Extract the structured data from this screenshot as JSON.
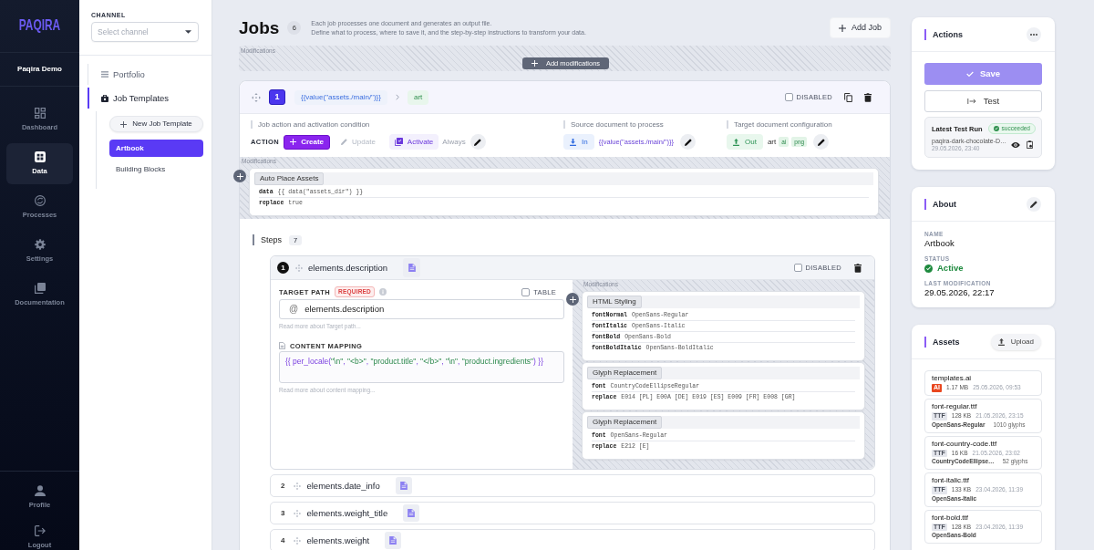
{
  "sidebar": {
    "logo": "PAQIRA",
    "workspace": "Paqira Demo",
    "items": [
      {
        "label": "Dashboard",
        "selected": false
      },
      {
        "label": "Data",
        "selected": true
      },
      {
        "label": "Processes",
        "selected": false
      },
      {
        "label": "Settings",
        "selected": false
      },
      {
        "label": "Documentation",
        "selected": false
      }
    ],
    "footer_items": [
      {
        "label": "Profile"
      },
      {
        "label": "Logout"
      }
    ]
  },
  "channel_panel": {
    "channel_label": "CHANNEL",
    "channel_select": {
      "placeholder": "Select channel"
    },
    "tree": [
      {
        "label": "Portfolio",
        "selected": false
      },
      {
        "label": "Job Templates",
        "selected": true
      }
    ],
    "new_template_button": "New Job Template",
    "templates": [
      {
        "label": "Artbook",
        "selected": true
      },
      {
        "label": "Building Blocks",
        "selected": false
      }
    ]
  },
  "header": {
    "title": "Jobs",
    "count": "6",
    "description": [
      "Each job processes one document and generates an output file.",
      "Define what to process, where to save it, and the step-by-step instructions to transform your data."
    ],
    "add_button": "Add Job"
  },
  "global_modifications": {
    "label": "Modifications",
    "add_button": "Add modifications"
  },
  "job": {
    "number": "1",
    "source": "{{value(\"assets./main/\")}}",
    "target": "art",
    "disabled": false,
    "disabled_label": "DISABLED",
    "action": {
      "title": "Job action and activation condition",
      "label": "ACTION",
      "options": [
        {
          "label": "Create",
          "selected": true
        },
        {
          "label": "Update",
          "selected": false
        }
      ],
      "activate": {
        "label": "Activate",
        "on": true
      },
      "condition": "Always"
    },
    "source_config": {
      "title": "Source document to process",
      "badge": "In",
      "value": "{{value(\"assets./main/\")}}"
    },
    "target_config": {
      "title": "Target document configuration",
      "badge": "Out",
      "name": "art",
      "formats": [
        "ai",
        "png"
      ]
    },
    "modifications": {
      "label": "Modifications",
      "items": [
        {
          "title": "Auto Place Assets",
          "params": [
            {
              "key": "data",
              "value": "{{ data(\"assets_dir\") }}"
            },
            {
              "key": "replace",
              "value": "true"
            }
          ]
        }
      ]
    },
    "steps": {
      "title": "Steps",
      "count": "7",
      "items": [
        {
          "number": "1",
          "name": "elements.description",
          "expanded": true,
          "disabled": false,
          "disabled_label": "DISABLED",
          "detail": {
            "target_path_label": "TARGET PATH",
            "required_badge": "REQUIRED",
            "table_label": "TABLE",
            "table": false,
            "prefix": "@",
            "target_path": "elements.description",
            "target_path_help": "Read more about Target path...",
            "content_mapping_label": "CONTENT MAPPING",
            "content_mapping": "{{ per_locale(\"\\n\", \"<b>\", \"product.title\", \"</b>\", \"\\n\", \"product.ingredients\") }}",
            "content_mapping_help": "Read more about content mapping...",
            "modifications": {
              "label": "Modifications",
              "items": [
                {
                  "title": "HTML Styling",
                  "params": [
                    {
                      "key": "fontNormal",
                      "value": "OpenSans-Regular"
                    },
                    {
                      "key": "fontItalic",
                      "value": "OpenSans-Italic"
                    },
                    {
                      "key": "fontBold",
                      "value": "OpenSans-Bold"
                    },
                    {
                      "key": "fontBoldItalic",
                      "value": "OpenSans-BoldItalic"
                    }
                  ]
                },
                {
                  "title": "Glyph Replacement",
                  "params": [
                    {
                      "key": "font",
                      "value": "CountryCodeEllipseRegular"
                    },
                    {
                      "key": "replace",
                      "value": "E014 [PL] E00A [DE] E019 [ES] E009 [FR] E008 [GR]"
                    }
                  ]
                },
                {
                  "title": "Glyph Replacement",
                  "params": [
                    {
                      "key": "font",
                      "value": "OpenSans-Regular"
                    },
                    {
                      "key": "replace",
                      "value": "E212 [E]"
                    }
                  ]
                }
              ]
            }
          }
        },
        {
          "number": "2",
          "name": "elements.date_info",
          "expanded": false,
          "disabled": false
        },
        {
          "number": "3",
          "name": "elements.weight_title",
          "expanded": false,
          "disabled": false
        },
        {
          "number": "4",
          "name": "elements.weight",
          "expanded": false,
          "disabled": false
        }
      ]
    }
  },
  "actions_card": {
    "title": "Actions",
    "save_button": "Save",
    "test_button": "Test",
    "latest_run": {
      "title": "Latest Test Run",
      "status": "succeeded",
      "file": "paqira-dark-chocolate-D…",
      "time": "29.05.2026, 23:40"
    }
  },
  "about_card": {
    "title": "About",
    "fields": [
      {
        "label": "NAME",
        "value": "Artbook",
        "kind": "text"
      },
      {
        "label": "STATUS",
        "value": "Active",
        "kind": "status"
      },
      {
        "label": "LAST MODIFICATION",
        "value": "29.05.2026, 22:17",
        "kind": "text"
      }
    ]
  },
  "assets_card": {
    "title": "Assets",
    "upload_button": "Upload",
    "files": [
      {
        "name": "templates.ai",
        "kind": "document",
        "type": "AI",
        "size": "1.17 MB",
        "date": "25.05.2026, 09:53"
      },
      {
        "name": "font-regular.ttf",
        "kind": "font",
        "type": "TTF",
        "size": "128 KB",
        "date": "21.05.2026, 23:15",
        "font": "OpenSans-Regular",
        "glyphs": "1010 glyphs"
      },
      {
        "name": "font-country-code.ttf",
        "kind": "font",
        "type": "TTF",
        "size": "16 KB",
        "date": "21.05.2026, 23:02",
        "font": "CountryCodeEllipse…",
        "glyphs": "52 glyphs"
      },
      {
        "name": "font-italic.ttf",
        "kind": "font",
        "type": "TTF",
        "size": "133 KB",
        "date": "23.04.2026, 11:39",
        "font": "OpenSans-Italic"
      },
      {
        "name": "font-bold.ttf",
        "kind": "font",
        "type": "TTF",
        "size": "128 KB",
        "date": "23.04.2026, 11:39",
        "font": "OpenSans-Bold"
      }
    ]
  }
}
